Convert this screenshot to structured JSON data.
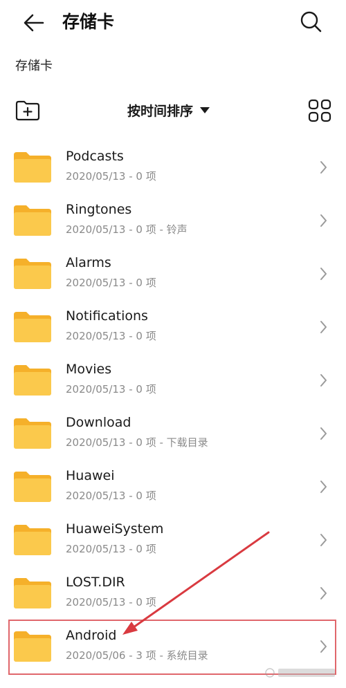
{
  "header": {
    "title": "存储卡"
  },
  "breadcrumb": {
    "label": "存储卡"
  },
  "toolbar": {
    "sort_label": "按时间排序"
  },
  "icons": {
    "back": "back-arrow-icon",
    "search": "search-icon",
    "new_folder": "new-folder-icon",
    "sort_dropdown": "caret-down-icon",
    "grid_view": "grid-view-icon",
    "folder": "folder-icon",
    "row_chevron": "chevron-right-icon"
  },
  "colors": {
    "folder": "#fbc94c",
    "folder_tab": "#f5b02a",
    "annotation": "#d93a40",
    "meta_text": "#8a8a8a"
  },
  "files": [
    {
      "name": "Podcasts",
      "meta": "2020/05/13 - 0 项"
    },
    {
      "name": "Ringtones",
      "meta": "2020/05/13 - 0 项 - 铃声"
    },
    {
      "name": "Alarms",
      "meta": "2020/05/13 - 0 项"
    },
    {
      "name": "Notifications",
      "meta": "2020/05/13 - 0 项"
    },
    {
      "name": "Movies",
      "meta": "2020/05/13 - 0 项"
    },
    {
      "name": "Download",
      "meta": "2020/05/13 - 0 项 - 下载目录"
    },
    {
      "name": "Huawei",
      "meta": "2020/05/13 - 0 项"
    },
    {
      "name": "HuaweiSystem",
      "meta": "2020/05/13 - 0 项"
    },
    {
      "name": "LOST.DIR",
      "meta": "2020/05/13 - 0 项"
    },
    {
      "name": "Android",
      "meta": "2020/05/06 - 3 项 - 系统目录"
    }
  ]
}
